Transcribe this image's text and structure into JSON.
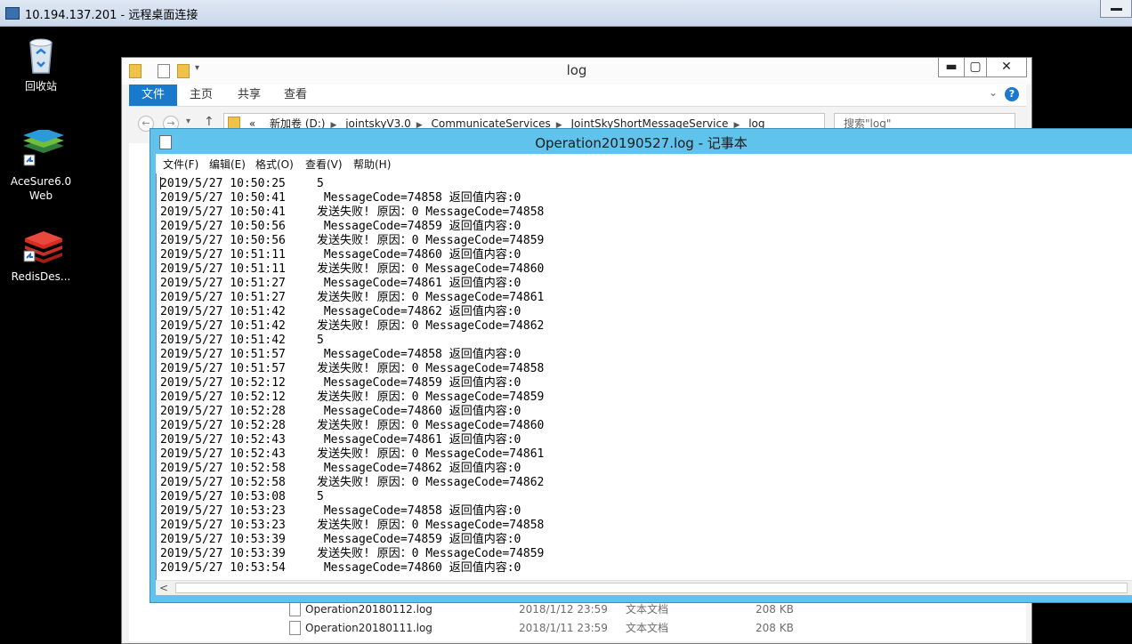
{
  "rdp": {
    "title": "10.194.137.201 - 远程桌面连接"
  },
  "desktop": {
    "icons": [
      {
        "label": "回收站",
        "icon": "recycle-bin-icon"
      },
      {
        "label": "AceSure6.0 Web",
        "icon": "layers-app-icon"
      },
      {
        "label": "RedisDes...",
        "icon": "redis-app-icon"
      }
    ]
  },
  "explorer": {
    "title": "log",
    "ribbon_tabs": [
      "文件",
      "主页",
      "共享",
      "查看"
    ],
    "address_path": [
      "«",
      "新加卷 (D:)",
      "jointskyV3.0",
      "CommunicateServices",
      "JointSkyShortMessageService",
      "log"
    ],
    "search_placeholder": "搜索\"log\"",
    "files": [
      {
        "name": "Operation20180112.log",
        "date": "2018/1/12 23:59",
        "type": "文本文档",
        "size": "208 KB"
      },
      {
        "name": "Operation20180111.log",
        "date": "2018/1/11 23:59",
        "type": "文本文档",
        "size": "208 KB"
      }
    ]
  },
  "notepad": {
    "title": "Operation20190527.log - 记事本",
    "menu": [
      "文件(F)",
      "编辑(E)",
      "格式(O)",
      "查看(V)",
      "帮助(H)"
    ],
    "lines": [
      {
        "ts": "2019/5/27 10:50:25",
        "msg": "5"
      },
      {
        "ts": "2019/5/27 10:50:41",
        "msg": " MessageCode=74858 返回值内容:0"
      },
      {
        "ts": "2019/5/27 10:50:41",
        "msg": "发送失败! 原因：0 MessageCode=74858"
      },
      {
        "ts": "2019/5/27 10:50:56",
        "msg": " MessageCode=74859 返回值内容:0"
      },
      {
        "ts": "2019/5/27 10:50:56",
        "msg": "发送失败! 原因：0 MessageCode=74859"
      },
      {
        "ts": "2019/5/27 10:51:11",
        "msg": " MessageCode=74860 返回值内容:0"
      },
      {
        "ts": "2019/5/27 10:51:11",
        "msg": "发送失败! 原因：0 MessageCode=74860"
      },
      {
        "ts": "2019/5/27 10:51:27",
        "msg": " MessageCode=74861 返回值内容:0"
      },
      {
        "ts": "2019/5/27 10:51:27",
        "msg": "发送失败! 原因：0 MessageCode=74861"
      },
      {
        "ts": "2019/5/27 10:51:42",
        "msg": " MessageCode=74862 返回值内容:0"
      },
      {
        "ts": "2019/5/27 10:51:42",
        "msg": "发送失败! 原因：0 MessageCode=74862"
      },
      {
        "ts": "2019/5/27 10:51:42",
        "msg": "5"
      },
      {
        "ts": "2019/5/27 10:51:57",
        "msg": " MessageCode=74858 返回值内容:0"
      },
      {
        "ts": "2019/5/27 10:51:57",
        "msg": "发送失败! 原因：0 MessageCode=74858"
      },
      {
        "ts": "2019/5/27 10:52:12",
        "msg": " MessageCode=74859 返回值内容:0"
      },
      {
        "ts": "2019/5/27 10:52:12",
        "msg": "发送失败! 原因：0 MessageCode=74859"
      },
      {
        "ts": "2019/5/27 10:52:28",
        "msg": " MessageCode=74860 返回值内容:0"
      },
      {
        "ts": "2019/5/27 10:52:28",
        "msg": "发送失败! 原因：0 MessageCode=74860"
      },
      {
        "ts": "2019/5/27 10:52:43",
        "msg": " MessageCode=74861 返回值内容:0"
      },
      {
        "ts": "2019/5/27 10:52:43",
        "msg": "发送失败! 原因：0 MessageCode=74861"
      },
      {
        "ts": "2019/5/27 10:52:58",
        "msg": " MessageCode=74862 返回值内容:0"
      },
      {
        "ts": "2019/5/27 10:52:58",
        "msg": "发送失败! 原因：0 MessageCode=74862"
      },
      {
        "ts": "2019/5/27 10:53:08",
        "msg": "5"
      },
      {
        "ts": "2019/5/27 10:53:23",
        "msg": " MessageCode=74858 返回值内容:0"
      },
      {
        "ts": "2019/5/27 10:53:23",
        "msg": "发送失败! 原因：0 MessageCode=74858"
      },
      {
        "ts": "2019/5/27 10:53:39",
        "msg": " MessageCode=74859 返回值内容:0"
      },
      {
        "ts": "2019/5/27 10:53:39",
        "msg": "发送失败! 原因：0 MessageCode=74859"
      },
      {
        "ts": "2019/5/27 10:53:54",
        "msg": " MessageCode=74860 返回值内容:0"
      }
    ]
  }
}
